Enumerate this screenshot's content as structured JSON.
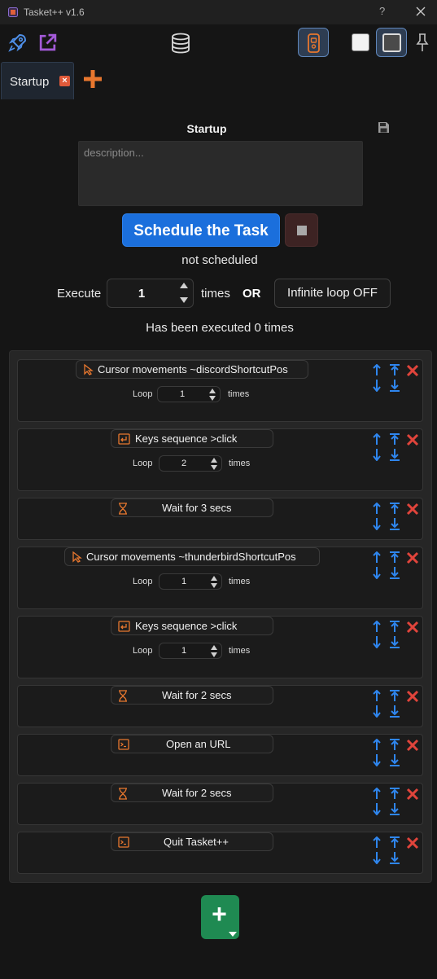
{
  "window": {
    "title": "Tasket++ v1.6",
    "help": "?",
    "close_icon": "close-icon"
  },
  "toolbar": {
    "left_icons": [
      "rocket-icon",
      "external-link-icon"
    ],
    "center_icon": "database-icon",
    "right_icons": [
      "phone-toggle-icon",
      "light-theme-icon",
      "dark-theme-icon",
      "pin-icon"
    ]
  },
  "tabs": [
    {
      "label": "Startup",
      "close_icon": "close-icon"
    }
  ],
  "tab_add_icon": "plus-icon",
  "task": {
    "title": "Startup",
    "description_placeholder": "description...",
    "schedule_label": "Schedule the Task",
    "status": "not scheduled",
    "execute_label": "Execute",
    "execute_value": "1",
    "times_label": "times",
    "or_label": "OR",
    "infinite_label": "Infinite loop OFF",
    "executed_text": "Has been executed 0 times"
  },
  "actions": [
    {
      "icon": "cursor-icon",
      "label": "Cursor movements ~discordShortcutPos",
      "loop_label": "Loop",
      "loop": "1",
      "loop_times": "times"
    },
    {
      "icon": "keys-icon",
      "label": "Keys sequence >click",
      "loop_label": "Loop",
      "loop": "2",
      "loop_times": "times"
    },
    {
      "icon": "hourglass-icon",
      "label": "Wait for 3 secs"
    },
    {
      "icon": "cursor-icon",
      "label": "Cursor movements ~thunderbirdShortcutPos",
      "loop_label": "Loop",
      "loop": "1",
      "loop_times": "times"
    },
    {
      "icon": "keys-icon",
      "label": "Keys sequence >click",
      "loop_label": "Loop",
      "loop": "1",
      "loop_times": "times"
    },
    {
      "icon": "hourglass-icon",
      "label": "Wait for 2 secs"
    },
    {
      "icon": "terminal-icon",
      "label": "Open an URL"
    },
    {
      "icon": "hourglass-icon",
      "label": "Wait for 2 secs"
    },
    {
      "icon": "terminal-icon",
      "label": "Quit Tasket++"
    }
  ],
  "add_action": {
    "label": "+",
    "icon": "chevron-down-icon"
  },
  "colors": {
    "accent_blue": "#1b6fdc",
    "orange": "#e8772e",
    "danger": "#e0443b",
    "green": "#1f8a52",
    "purple": "#a35ad8"
  }
}
